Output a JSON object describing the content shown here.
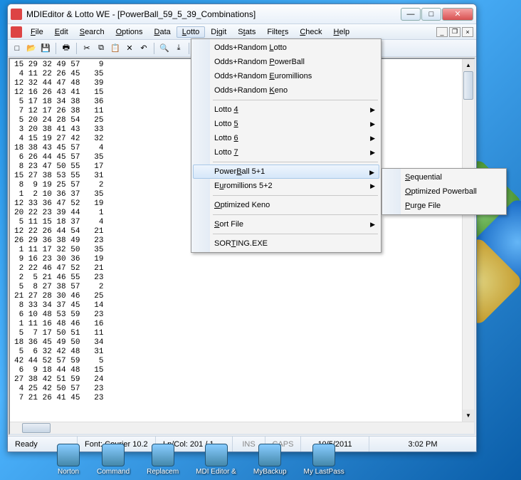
{
  "window": {
    "title": "MDIEditor & Lotto WE - [PowerBall_59_5_39_Combinations]"
  },
  "menubar": {
    "items": [
      "File",
      "Edit",
      "Search",
      "Options",
      "Data",
      "Lotto",
      "Digit",
      "Stats",
      "Filters",
      "Check",
      "Help"
    ],
    "open": "Lotto"
  },
  "lotto_menu": {
    "g1": [
      "Odds+Random Lotto",
      "Odds+Random PowerBall",
      "Odds+Random Euromillions",
      "Odds+Random Keno"
    ],
    "g2": [
      "Lotto 4",
      "Lotto 5",
      "Lotto 6",
      "Lotto 7"
    ],
    "g3": [
      "PowerBall 5+1",
      "Euromillions 5+2"
    ],
    "g4": [
      "Optimized Keno"
    ],
    "g5": [
      "Sort File"
    ],
    "g6": [
      "SORTING.EXE"
    ],
    "selected": "PowerBall 5+1"
  },
  "sub_menu": {
    "items": [
      "Sequential",
      "Optimized Powerball",
      "Purge File"
    ]
  },
  "editor_lines": [
    "15 29 32 49 57    9",
    " 4 11 22 26 45   35",
    "12 32 44 47 48   39",
    "12 16 26 43 41   15",
    " 5 17 18 34 38   36",
    " 7 12 17 26 38   11",
    " 5 20 24 28 54   25",
    " 3 20 38 41 43   33",
    " 4 15 19 27 42   32",
    "18 38 43 45 57    4",
    " 6 26 44 45 57   35",
    " 8 23 47 50 55   17",
    "15 27 38 53 55   31",
    " 8  9 19 25 57    2",
    " 1  2 10 36 37   35",
    "12 33 36 47 52   19",
    "20 22 23 39 44    1",
    " 5 11 15 18 37    4",
    "12 22 26 44 54   21",
    "26 29 36 38 49   23",
    " 1 11 17 32 50   35",
    " 9 16 23 30 36   19",
    " 2 22 46 47 52   21",
    " 2  5 21 46 55   23",
    " 5  8 27 38 57    2",
    "21 27 28 30 46   25",
    " 8 33 34 37 45   14",
    " 6 10 48 53 59   23",
    " 1 11 16 48 46   16",
    " 5  7 17 50 51   11",
    "18 36 45 49 50   34",
    " 5  6 32 42 48   31",
    "42 44 52 57 59    5",
    " 6  9 18 44 48   15",
    "27 38 42 51 59   24",
    " 4 25 42 50 57   23",
    " 7 21 26 41 45   23"
  ],
  "status": {
    "ready": "Ready",
    "font": "Font: Courier 10.2",
    "lncol": "Ln/Col: 201 / 1",
    "ins": "INS",
    "caps": "CAPS",
    "date": "10/5/2011",
    "time": "3:02 PM"
  },
  "taskbar": [
    "Norton",
    "Command",
    "Replacem",
    "MDI Editor &",
    "MyBackup",
    "My LastPass"
  ]
}
